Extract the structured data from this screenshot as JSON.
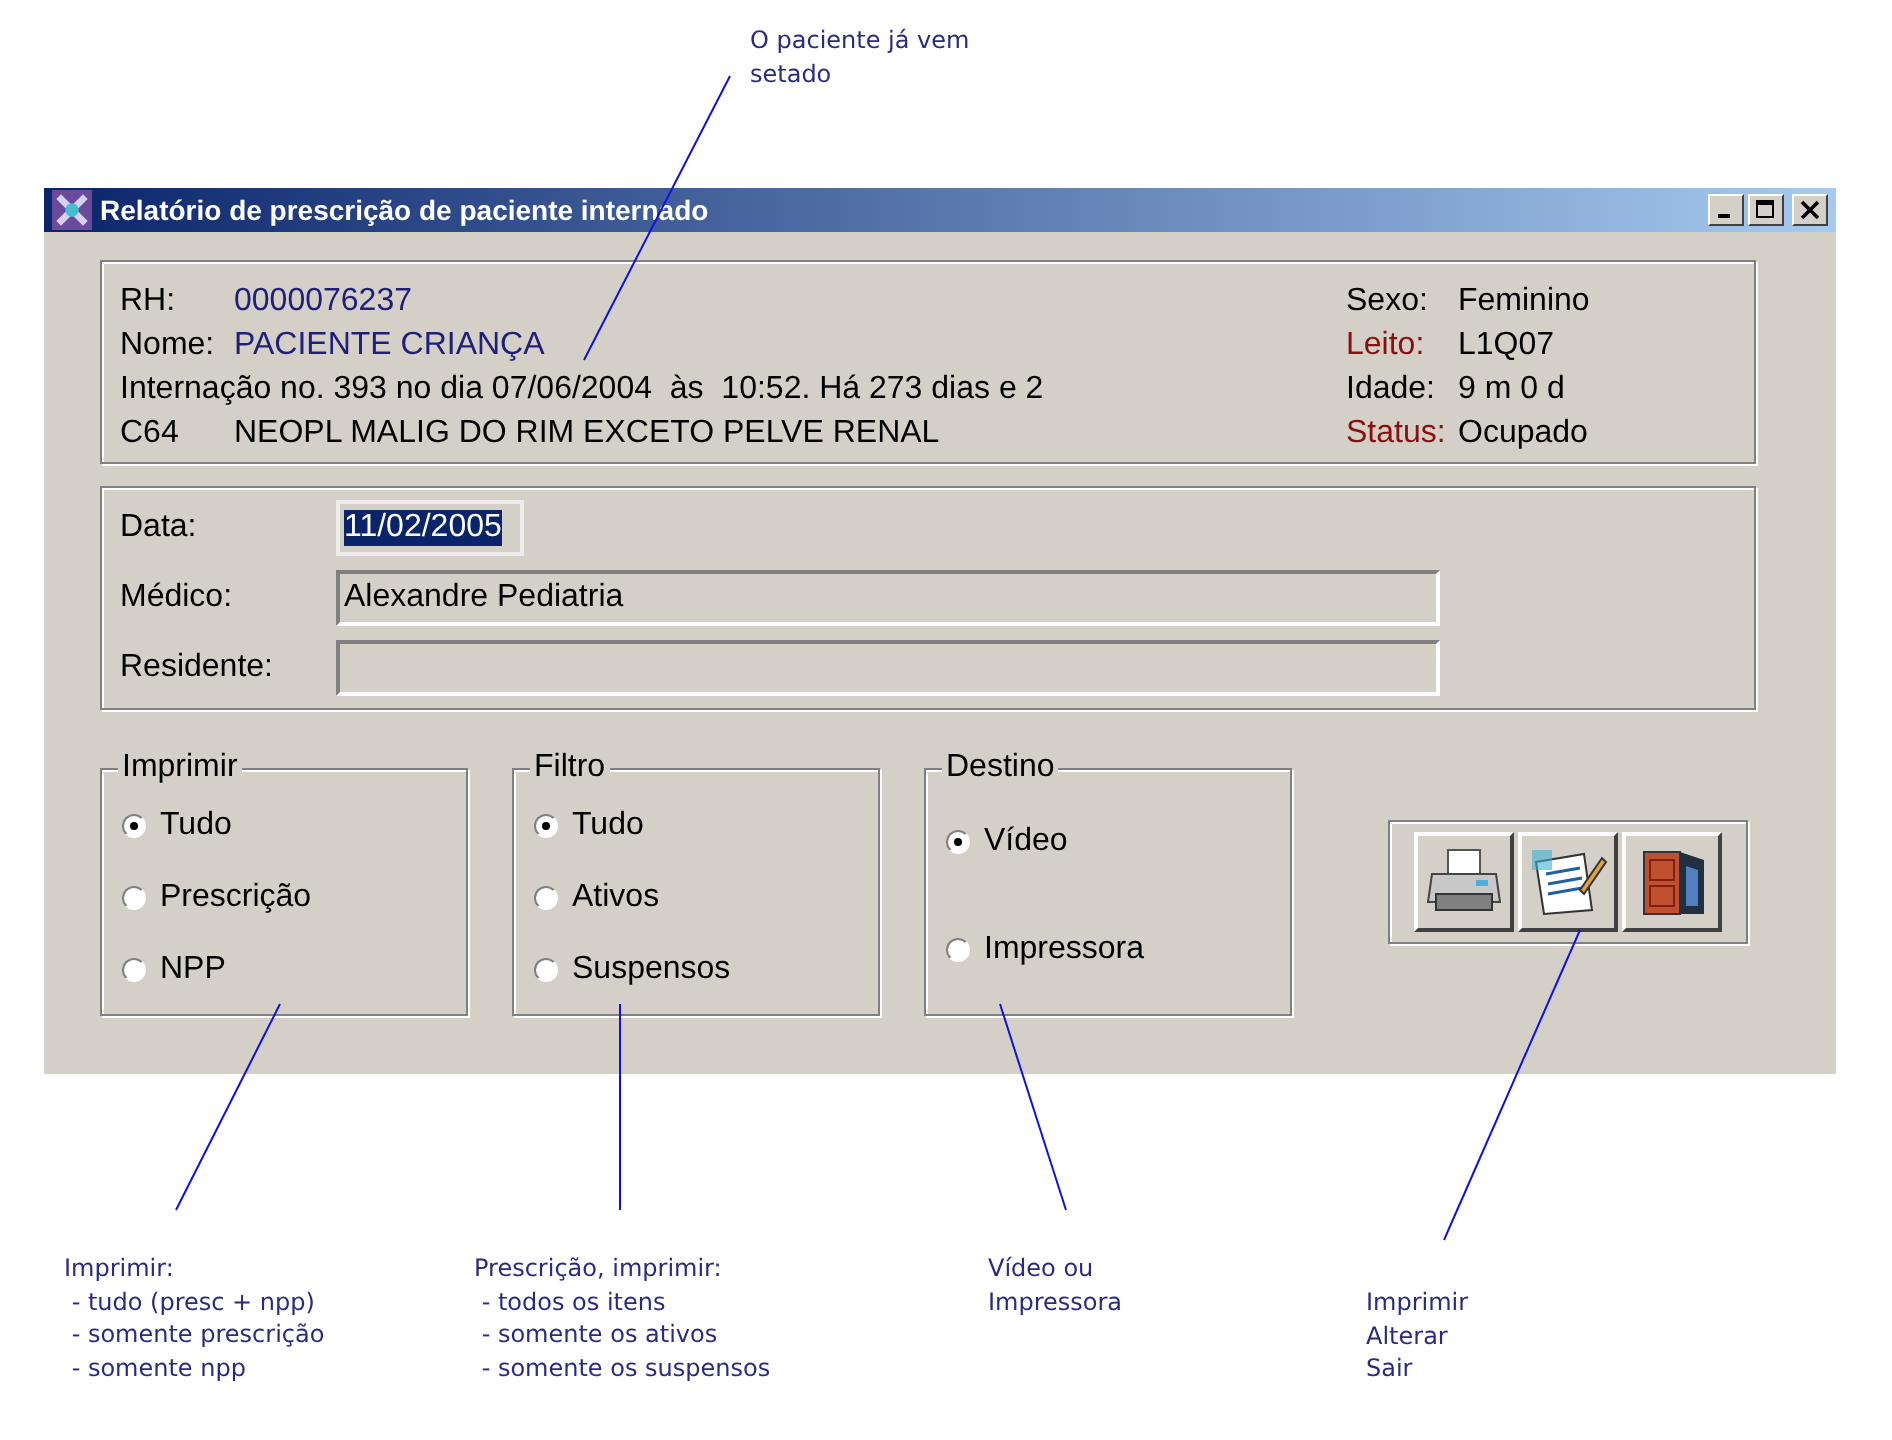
{
  "window": {
    "title": "Relatório de prescrição de paciente internado"
  },
  "patient": {
    "left": [
      {
        "label": "RH:",
        "value": "0000076237"
      },
      {
        "label": "Nome:",
        "value": "PACIENTE CRIANÇA"
      }
    ],
    "admission": "Internação no. 393 no dia 07/06/2004  às  10:52. Há 273 dias e 2",
    "diagnosis_code": "C64",
    "diagnosis": "NEOPL MALIG DO RIM EXCETO PELVE RENAL",
    "right": [
      {
        "label": "Sexo:",
        "value": "Feminino",
        "emphasis": false
      },
      {
        "label": "Leito:",
        "value": "L1Q07",
        "emphasis": true
      },
      {
        "label": "Idade:",
        "value": "9 m 0 d",
        "emphasis": false
      },
      {
        "label": "Status:",
        "value": "Ocupado",
        "emphasis": true
      }
    ]
  },
  "form": [
    {
      "label": "Data:",
      "value": "11/02/2005",
      "selected": true,
      "kind": "short"
    },
    {
      "label": "Médico:",
      "value": "Alexandre Pediatria",
      "selected": false,
      "kind": "long"
    },
    {
      "label": "Residente:",
      "selected": false,
      "kind": "long"
    }
  ],
  "groups": [
    {
      "title": "Imprimir",
      "spread": false,
      "options": [
        {
          "label": "Tudo",
          "selected": true
        },
        {
          "label": "Prescrição",
          "selected": false
        },
        {
          "label": "NPP",
          "selected": false
        }
      ]
    },
    {
      "title": "Filtro",
      "spread": false,
      "options": [
        {
          "label": "Tudo",
          "selected": true
        },
        {
          "label": "Ativos",
          "selected": false
        },
        {
          "label": "Suspensos",
          "selected": false
        }
      ]
    },
    {
      "title": "Destino",
      "spread": true,
      "options": [
        {
          "label": "Vídeo",
          "selected": true
        },
        {
          "label": "Impressora",
          "selected": false
        }
      ]
    }
  ],
  "actions": [
    {
      "kind": "print"
    },
    {
      "kind": "edit"
    },
    {
      "kind": "exit"
    }
  ],
  "notes": [
    {
      "lines": [
        "O paciente já vem",
        "setado"
      ]
    },
    {
      "lines": [
        "Imprimir:",
        " - tudo (presc + npp)",
        " - somente prescrição",
        " - somente npp"
      ]
    },
    {
      "lines": [
        "Prescrição, imprimir:",
        " - todos os itens",
        " - somente os ativos",
        " - somente os suspensos"
      ]
    },
    {
      "lines": [
        "Vídeo ou",
        "Impressora"
      ]
    },
    {
      "lines": [
        "Imprimir",
        "Alterar",
        "Sair"
      ]
    }
  ]
}
